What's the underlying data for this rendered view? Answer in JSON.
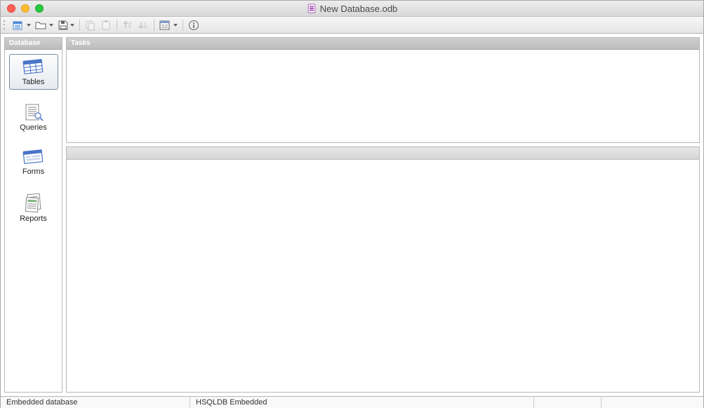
{
  "window": {
    "title": "New Database.odb"
  },
  "sidebar": {
    "header": "Database",
    "items": [
      {
        "label": "Tables"
      },
      {
        "label": "Queries"
      },
      {
        "label": "Forms"
      },
      {
        "label": "Reports"
      }
    ],
    "selected": 0
  },
  "tasks": {
    "header": "Tasks"
  },
  "statusbar": {
    "left": "Embedded database",
    "engine": "HSQLDB Embedded"
  }
}
